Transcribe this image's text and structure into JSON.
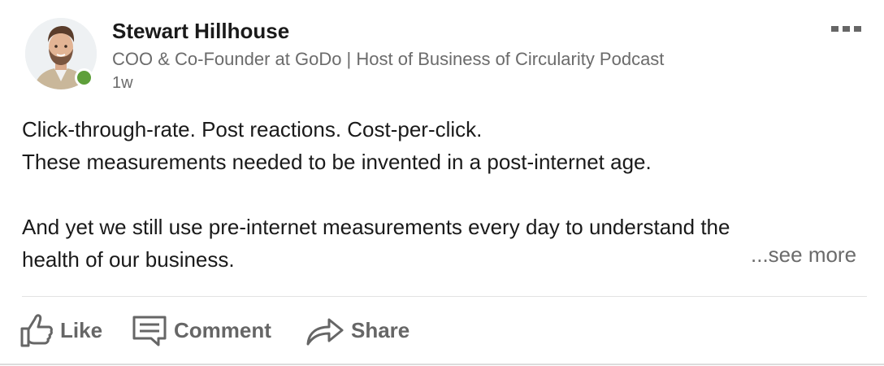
{
  "post": {
    "author": {
      "name": "Stewart Hillhouse",
      "headline": "COO & Co-Founder at GoDo | Host of Business of Circularity Podcast",
      "time": "1w",
      "presence_color": "#5e9f3a"
    },
    "menu_icon": "more-horizontal-icon",
    "body": {
      "lines": [
        "Click-through-rate. Post reactions. Cost-per-click.",
        "These measurements needed to be invented in a post-internet age.",
        "",
        "And yet we still use pre-internet measurements every day to understand the",
        "health of our business."
      ],
      "see_more": "...see more"
    },
    "actions": [
      {
        "label": "Like",
        "icon": "thumbs-up-icon"
      },
      {
        "label": "Comment",
        "icon": "comment-icon"
      },
      {
        "label": "Share",
        "icon": "share-arrow-icon"
      }
    ]
  }
}
